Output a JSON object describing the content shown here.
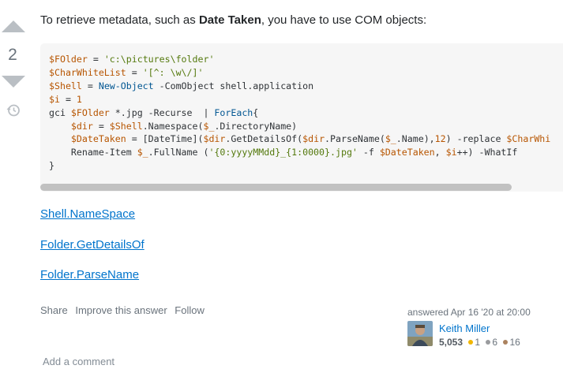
{
  "vote": {
    "count": "2",
    "up_icon": "arrow-up-icon",
    "down_icon": "arrow-down-icon",
    "history_icon": "history-icon"
  },
  "answer": {
    "intro_before": "To retrieve metadata, such as ",
    "intro_bold": "Date Taken",
    "intro_after": ", you have to use COM objects:",
    "code_lines": [
      "$FOlder = 'c:\\pictures\\folder'",
      "$CharWhiteList = '[^: \\w\\/]'",
      "$Shell = New-Object -ComObject shell.application",
      "$i = 1",
      "gci $FOlder *.jpg -Recurse  | ForEach{",
      "    $dir = $Shell.Namespace($_.DirectoryName)",
      "    $DateTaken = [DateTime]($dir.GetDetailsOf($dir.ParseName($_.Name),12) -replace $CharWhi",
      "    Rename-Item $_.FullName ('{0:yyyyMMdd}_{1:0000}.jpg' -f $DateTaken, $i++) -WhatIf",
      "}"
    ],
    "links": [
      "Shell.NameSpace",
      "Folder.GetDetailsOf",
      "Folder.ParseName"
    ]
  },
  "post_menu": {
    "share": "Share",
    "improve": "Improve this answer",
    "follow": "Follow"
  },
  "user_card": {
    "answered": "answered Apr 16 '20 at 20:00",
    "name": "Keith Miller",
    "reputation": "5,053",
    "gold": "1",
    "silver": "6",
    "bronze": "16",
    "gold_color": "#f1b600",
    "silver_color": "#9a9b9e",
    "bronze_color": "#ab825f"
  },
  "comments": {
    "add_label": "Add a comment"
  }
}
